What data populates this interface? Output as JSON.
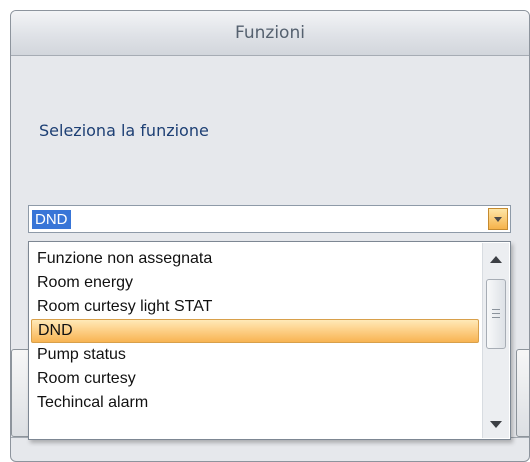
{
  "window": {
    "title": "Funzioni"
  },
  "prompt": {
    "label": "Seleziona la funzione"
  },
  "combo": {
    "selected_value": "DND"
  },
  "dropdown": {
    "options": [
      "Funzione non assegnata",
      "Room energy",
      "Room curtesy light STAT",
      "DND",
      "Pump status",
      "Room curtesy",
      "Techincal alarm"
    ],
    "selected_index": 3
  },
  "colors": {
    "accent_highlight": "#3875d7",
    "selected_item": "#f8b453",
    "prompt_text": "#1d3f74"
  },
  "icons": {
    "combo_arrow": "chevron-down-icon",
    "scroll_up": "scroll-up-arrow-icon",
    "scroll_down": "scroll-down-arrow-icon",
    "thumb_grip": "grip-icon"
  }
}
